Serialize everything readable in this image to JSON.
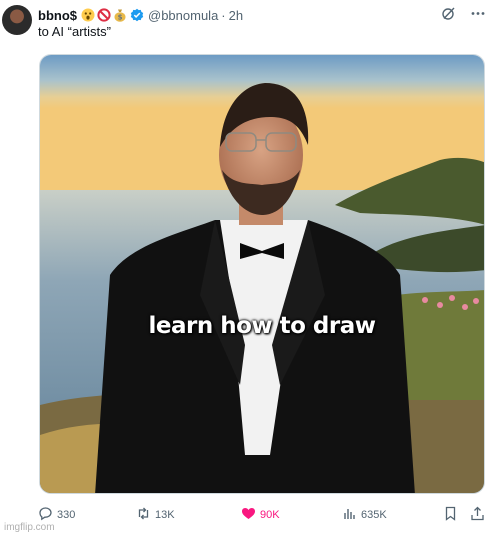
{
  "tweet": {
    "display_name": "bbno$",
    "name_emojis": [
      "astonished-face",
      "prohibited",
      "money-bag"
    ],
    "handle": "@bbnomula",
    "separator": "·",
    "time": "2h",
    "text": "to AI “artists”"
  },
  "media": {
    "caption": "learn how to draw"
  },
  "actions": {
    "replies": "330",
    "reposts": "13K",
    "likes": "90K",
    "views": "635K"
  },
  "watermark": "imgflip.com",
  "colors": {
    "like_active": "#f91880",
    "verified_blue": "#1d9bf0",
    "muted_text": "#536471"
  }
}
